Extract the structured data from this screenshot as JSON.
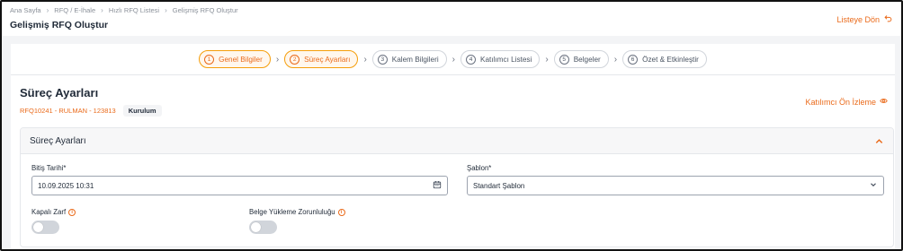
{
  "breadcrumb": [
    "Ana Sayfa",
    "RFQ / E-İhale",
    "Hızlı RFQ Listesi",
    "Gelişmiş RFQ Oluştur"
  ],
  "page_title": "Gelişmiş RFQ Oluştur",
  "back_label": "Listeye Dön",
  "steps": [
    {
      "num": "1",
      "label": "Genel Bilgiler",
      "state": "active"
    },
    {
      "num": "2",
      "label": "Süreç Ayarları",
      "state": "active"
    },
    {
      "num": "3",
      "label": "Kalem Bilgileri",
      "state": "inactive"
    },
    {
      "num": "4",
      "label": "Katılımcı Listesi",
      "state": "inactive"
    },
    {
      "num": "5",
      "label": "Belgeler",
      "state": "inactive"
    },
    {
      "num": "6",
      "label": "Özet & Etkinleştir",
      "state": "inactive"
    }
  ],
  "section": {
    "title": "Süreç Ayarları",
    "rfq_code": "RFQ10241 - RULMAN - 123813",
    "badge": "Kurulum",
    "preview_label": "Katılımcı Ön İzleme"
  },
  "card": {
    "title": "Süreç Ayarları",
    "end_date_label": "Bitiş Tarihi*",
    "end_date_value": "10.09.2025 10:31",
    "template_label": "Şablon*",
    "template_value": "Standart Şablon",
    "sealed_bid_label": "Kapalı Zarf",
    "sealed_bid_on": false,
    "doc_upload_label": "Belge Yükleme Zorunluluğu",
    "doc_upload_on": false
  },
  "colors": {
    "accent": "#ea6a1a",
    "active_step_bg": "#fff7ed"
  }
}
